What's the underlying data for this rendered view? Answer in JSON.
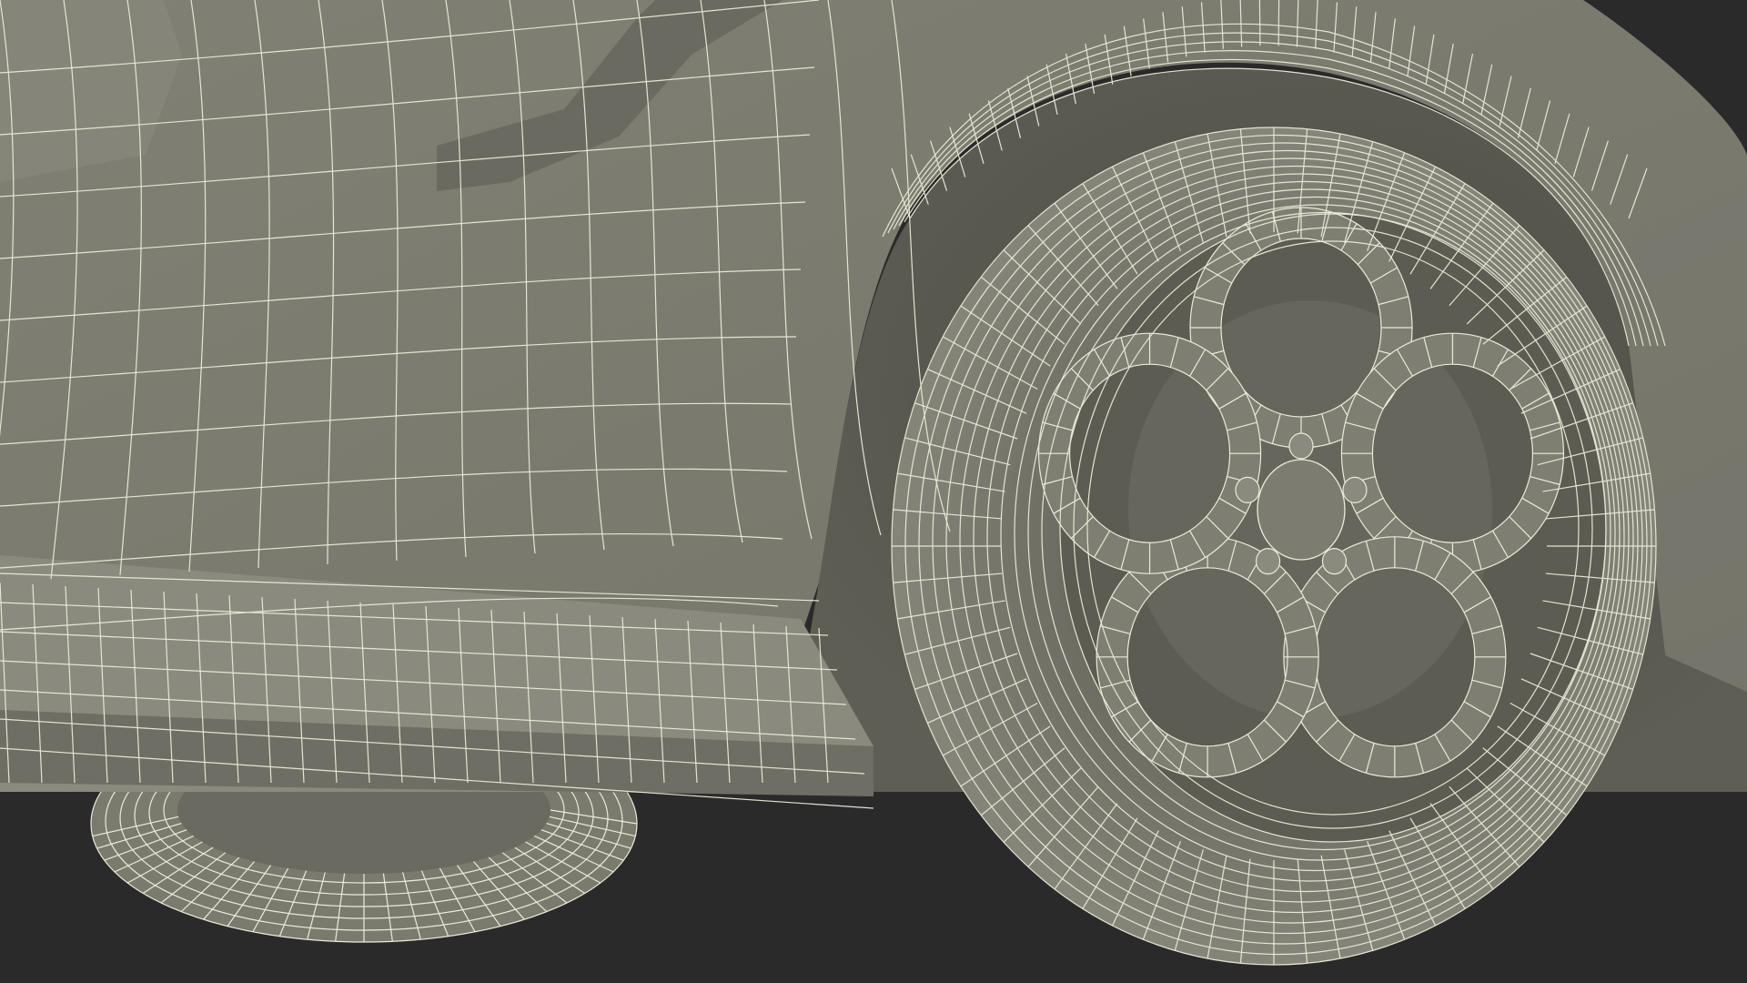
{
  "scene": {
    "subject": "wireframe-render",
    "colors": {
      "background": "#2a2a2a",
      "surface": "#7c7c70",
      "surface_light": "#8b8b7e",
      "surface_dark": "#5a5a50",
      "shadow": "#45453e",
      "wire": "#ecebd9"
    }
  }
}
